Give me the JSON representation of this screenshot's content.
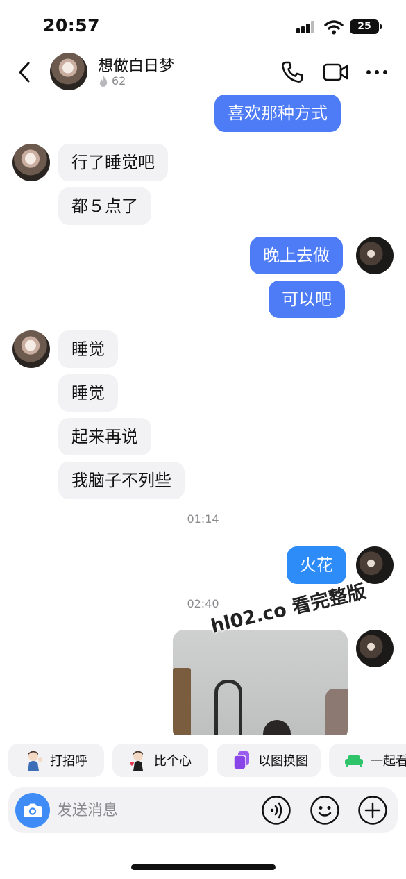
{
  "status_bar": {
    "time": "20:57",
    "battery": "25",
    "icons": [
      "cellular-signal-icon",
      "wifi-icon",
      "battery-icon"
    ]
  },
  "header": {
    "contact_name": "想做白日梦",
    "streak_count": "62",
    "icons": [
      "back-icon",
      "phone-icon",
      "video-icon",
      "more-icon"
    ]
  },
  "messages": [
    {
      "side": "out",
      "text": "喜欢那种方式"
    },
    {
      "side": "in",
      "text": "行了睡觉吧"
    },
    {
      "side": "in",
      "text": "都５点了"
    },
    {
      "side": "out",
      "text": "晚上去做"
    },
    {
      "side": "out",
      "text": "可以吧"
    },
    {
      "side": "in",
      "text": "睡觉"
    },
    {
      "side": "in",
      "text": "睡觉"
    },
    {
      "side": "in",
      "text": "起来再说"
    },
    {
      "side": "in",
      "text": "我脑子不列些"
    },
    {
      "side": "time",
      "text": "01:14"
    },
    {
      "side": "out",
      "text": "火花"
    },
    {
      "side": "time",
      "text": "02:40"
    },
    {
      "side": "out",
      "type": "image"
    }
  ],
  "watermark": "hl02.co 看完整版",
  "quick_actions": [
    {
      "label": "打招呼",
      "icon": "wave-avatar-icon"
    },
    {
      "label": "比个心",
      "icon": "heart-avatar-icon"
    },
    {
      "label": "以图换图",
      "icon": "photo-swap-icon"
    },
    {
      "label": "一起看",
      "icon": "sofa-icon"
    }
  ],
  "input": {
    "placeholder": "发送消息",
    "icons": [
      "camera-icon",
      "voice-icon",
      "emoji-icon",
      "plus-icon"
    ]
  },
  "colors": {
    "outgoing_bubble": "#4e7cf6",
    "spark_bubble": "#2d8cf8",
    "incoming_bubble": "#f2f2f4",
    "camera_button": "#3f8cf7"
  }
}
